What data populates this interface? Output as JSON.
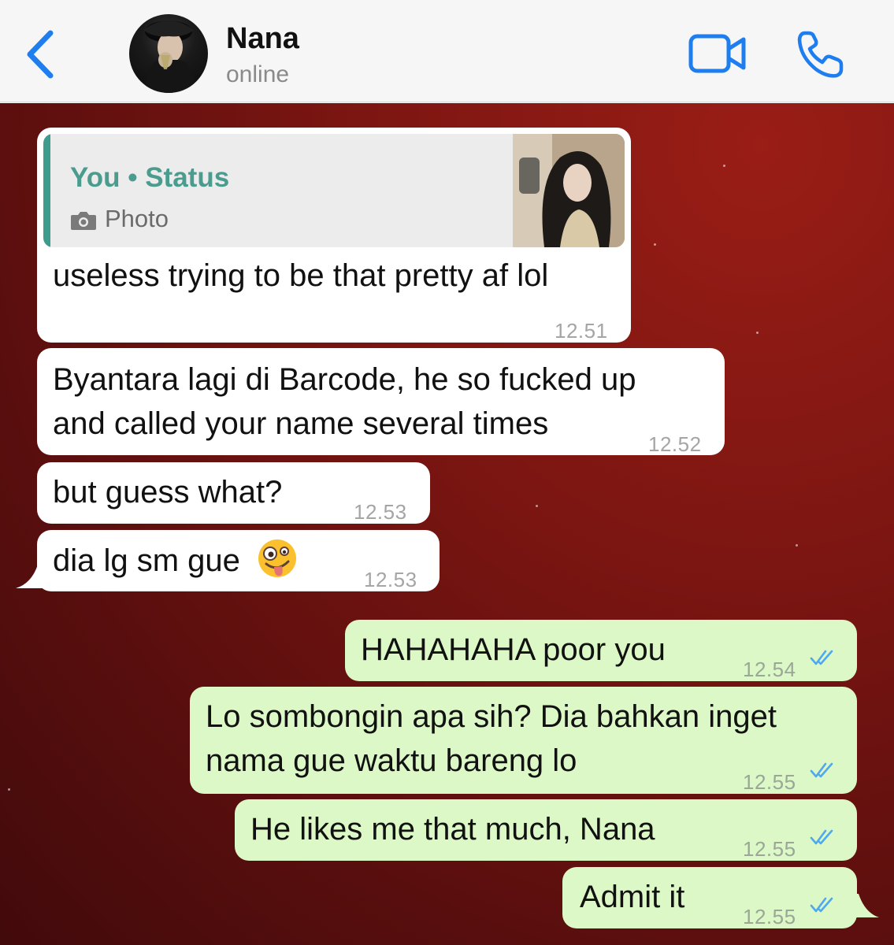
{
  "header": {
    "contact_name": "Nana",
    "status": "online",
    "accent_color": "#1e7ef0"
  },
  "messages": {
    "m1": {
      "reply_title": "You • Status",
      "reply_sub": "Photo",
      "text": "useless trying to be that pretty af lol",
      "time": "12.51"
    },
    "m2": {
      "line1": "Byantara lagi di Barcode, he so fucked up",
      "line2": "and called your name several times",
      "time": "12.52"
    },
    "m3": {
      "text": "but guess what?",
      "time": "12.53"
    },
    "m4": {
      "text": "dia lg sm gue",
      "emoji": "zany-face",
      "time": "12.53"
    },
    "m5": {
      "text": "HAHAHAHA poor you",
      "time": "12.54"
    },
    "m6": {
      "line1": "Lo sombongin apa sih? Dia bahkan inget",
      "line2": "nama gue waktu bareng lo",
      "time": "12.55"
    },
    "m7": {
      "text": "He likes me that much, Nana",
      "time": "12.55"
    },
    "m8": {
      "text": "Admit it",
      "time": "12.55"
    }
  },
  "colors": {
    "incoming_bubble": "#ffffff",
    "outgoing_bubble": "#dcf8c6",
    "read_ticks": "#4fa8f0",
    "background": "#7e1612"
  }
}
